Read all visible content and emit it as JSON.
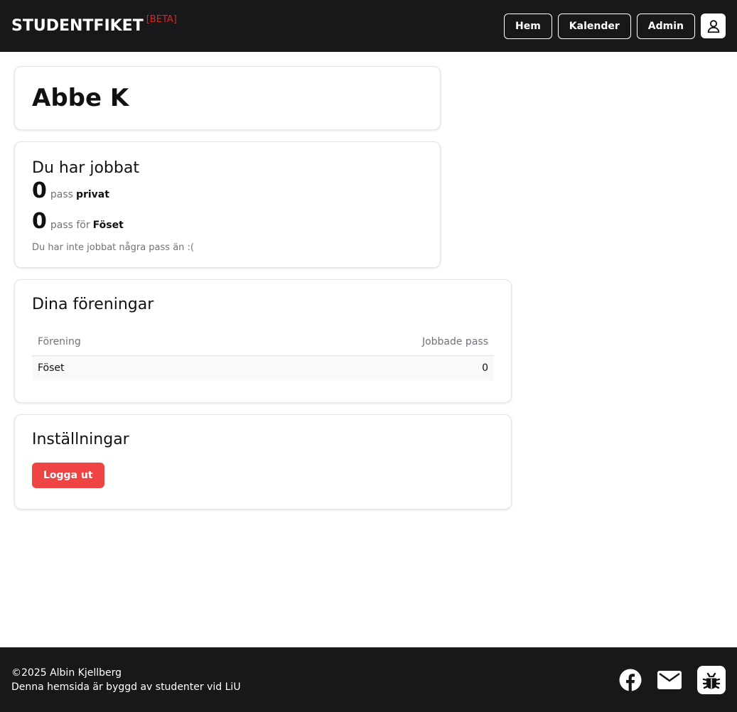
{
  "header": {
    "brand": "STUDENTFIKET",
    "beta": "[BETA]",
    "nav": {
      "home": "Hem",
      "calendar": "Kalender",
      "admin": "Admin"
    },
    "user_icon": "user-icon"
  },
  "profile": {
    "name": "Abbe K"
  },
  "worked": {
    "title": "Du har jobbat",
    "private": {
      "count": "0",
      "label": "pass",
      "target": "privat"
    },
    "association": {
      "count": "0",
      "label": "pass för",
      "target": "Föset"
    },
    "note": "Du har inte jobbat några pass än :("
  },
  "associations": {
    "title": "Dina föreningar",
    "columns": [
      "Förening",
      "Jobbade pass"
    ],
    "rows": [
      {
        "name": "Föset",
        "shifts": "0"
      }
    ]
  },
  "settings": {
    "title": "Inställningar",
    "logout": "Logga ut"
  },
  "footer": {
    "copyright": "©2025 Albin Kjellberg",
    "built_by": "Denna hemsida är byggd av studenter vid LiU",
    "icons": [
      "facebook-icon",
      "mail-icon",
      "bug-icon"
    ]
  },
  "colors": {
    "header_bg": "#18181b",
    "beta": "#dc2626",
    "logout_bg": "#ef4444"
  }
}
